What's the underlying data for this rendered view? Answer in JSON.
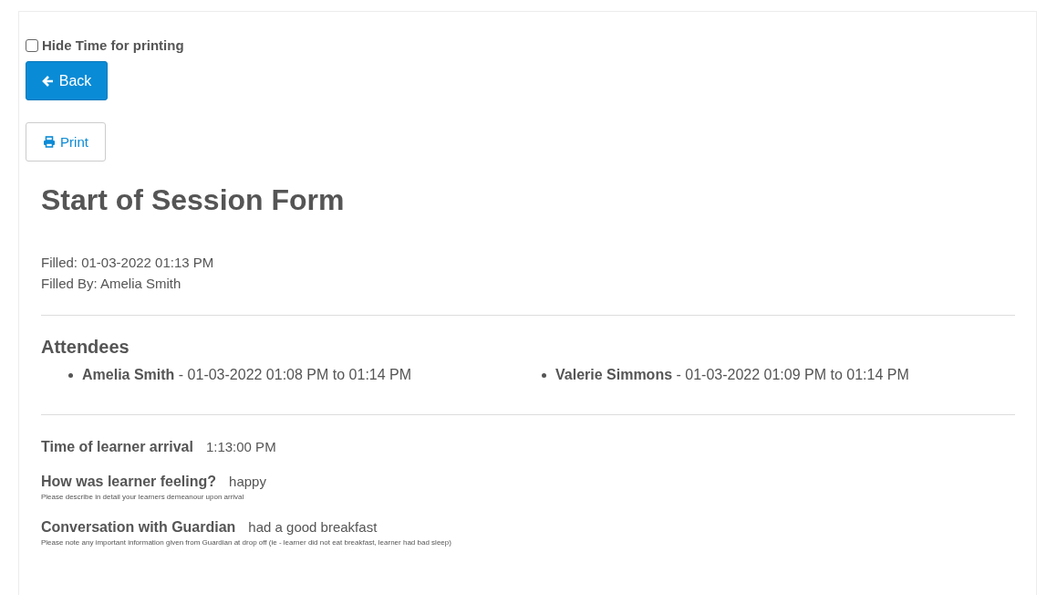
{
  "hide_time_checkbox": {
    "label": "Hide Time for printing",
    "checked": false
  },
  "back_button": {
    "label": "Back"
  },
  "print_button": {
    "label": "Print"
  },
  "title": "Start of Session Form",
  "meta": [
    "Filled: 01-03-2022 01:13 PM",
    "Filled By: Amelia Smith"
  ],
  "attendees": {
    "heading": "Attendees",
    "items": [
      {
        "text": "**Amelia Smith** - 01-03-2022 01:08 PM to 01:14 PM"
      },
      {
        "text": "**Valerie Simmons** - 01-03-2022 01:09 PM to 01:14 PM"
      }
    ]
  },
  "fields": [
    {
      "label": "Time of learner arrival",
      "value": "1:13:00 PM"
    },
    {
      "label": "How was learner feeling?",
      "value": "happy",
      "help": "Please describe in detail your learners demeanour upon arrival"
    },
    {
      "label": "Conversation with Guardian",
      "value": "had a good breakfast",
      "help": "Please note any important information given from Guardian at drop off (ie - learner did not eat breakfast, learner had bad sleep)"
    }
  ]
}
